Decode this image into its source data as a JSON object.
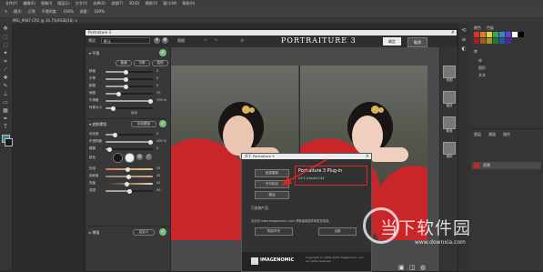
{
  "ps": {
    "menu": [
      "文件(F)",
      "编辑(E)",
      "图像(I)",
      "图层(L)",
      "文字(Y)",
      "选择(S)",
      "滤镜(T)",
      "3D(D)",
      "视图(V)",
      "窗口(W)",
      "帮助(H)"
    ],
    "options": [
      "模式:",
      "正常",
      "不透明度:",
      "100%",
      "流量:",
      "100%"
    ],
    "doc_tab": "IMG_9987.CR2 @ 16.7%(RGB/16) ×",
    "panel": {
      "tabs": [
        "颜色",
        "色板",
        "库"
      ],
      "lib_items": [
        "库",
        "图形",
        "文本"
      ],
      "layers_tabs": [
        "图层",
        "通道",
        "路径"
      ],
      "layer_name": "背景"
    }
  },
  "plugin": {
    "window_title": "Portraiture 3",
    "logo": "PORTRAITURE 3",
    "preset_label": "预设",
    "preset_value": "默认",
    "view_label": "视图",
    "ok_label": "确定",
    "cancel_label": "取消",
    "sections": {
      "smooth": {
        "title": "平滑",
        "buttons": [
          "普通",
          "中等",
          "强烈"
        ],
        "sliders": [
          {
            "label": "精细",
            "value": "0"
          },
          {
            "label": "中等",
            "value": "0"
          },
          {
            "label": "粗糙",
            "value": "0"
          },
          {
            "label": "阈值",
            "value": "10"
          },
          {
            "label": "平滑度",
            "value": "100 %"
          }
        ],
        "extra_label": "肖像大小",
        "extra_value": "自动"
      },
      "mask": {
        "title": "皮肤蒙版",
        "auto_label": "自动蒙版",
        "sliders": [
          {
            "label": "羽化度",
            "value": "5"
          },
          {
            "label": "不透明度",
            "value": "100 %"
          },
          {
            "label": "模糊",
            "value": "0"
          }
        ],
        "picker_label": "肤色",
        "sliders2": [
          {
            "label": "色相",
            "value": "25"
          },
          {
            "label": "饱和度",
            "value": "45"
          },
          {
            "label": "亮度",
            "value": "41"
          },
          {
            "label": "范围",
            "value": "50"
          }
        ]
      },
      "enhance": {
        "title": "增强",
        "auto_label": "自定义"
      }
    },
    "right_panel": [
      "视图",
      "缩放",
      "覆盖",
      "辅助"
    ]
  },
  "about": {
    "title": "关于 Portraiture 3",
    "buttons": [
      "检查更新",
      "许可协议",
      "激活"
    ],
    "plugin_name": "Portraiture 3 Plug-in",
    "plugin_version": "v3.5.4 build 144",
    "install_label": "已安装产品",
    "note": "请访问 www.imagenomic.com 获取最新插件和更多信息。",
    "bottom_buttons": [
      "购买许可",
      "试用"
    ],
    "logo_text": "IMAGENOMIC",
    "copyright": "Copyright (c) 2004-2020 Imagenomic, LLC. All rights reserved."
  },
  "watermark": {
    "text": "当下软件园",
    "url": "www.downxia.com"
  }
}
